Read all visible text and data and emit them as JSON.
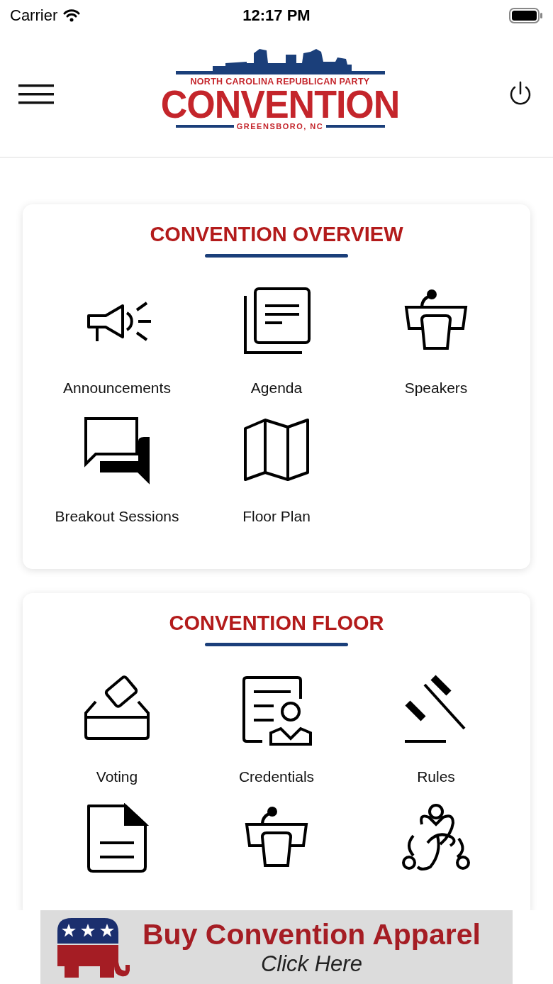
{
  "status_bar": {
    "carrier": "Carrier",
    "time": "12:17 PM"
  },
  "header": {
    "logo": {
      "top_line": "NORTH CAROLINA REPUBLICAN PARTY",
      "main": "CONVENTION",
      "bottom_line": "GREENSBORO, NC"
    }
  },
  "sections": [
    {
      "title": "CONVENTION OVERVIEW",
      "items": [
        {
          "kind": "megaphone",
          "label": "Announcements"
        },
        {
          "kind": "pages",
          "label": "Agenda"
        },
        {
          "kind": "podium",
          "label": "Speakers"
        },
        {
          "kind": "chat",
          "label": "Breakout Sessions"
        },
        {
          "kind": "map",
          "label": "Floor Plan"
        }
      ]
    },
    {
      "title": "CONVENTION FLOOR",
      "items": [
        {
          "kind": "ballot",
          "label": "Voting"
        },
        {
          "kind": "credential",
          "label": "Credentials"
        },
        {
          "kind": "gavel",
          "label": "Rules"
        },
        {
          "kind": "document"
        },
        {
          "kind": "podium"
        },
        {
          "kind": "network"
        }
      ]
    }
  ],
  "banner": {
    "title": "Buy Convention Apparel",
    "subtitle": "Click Here"
  }
}
